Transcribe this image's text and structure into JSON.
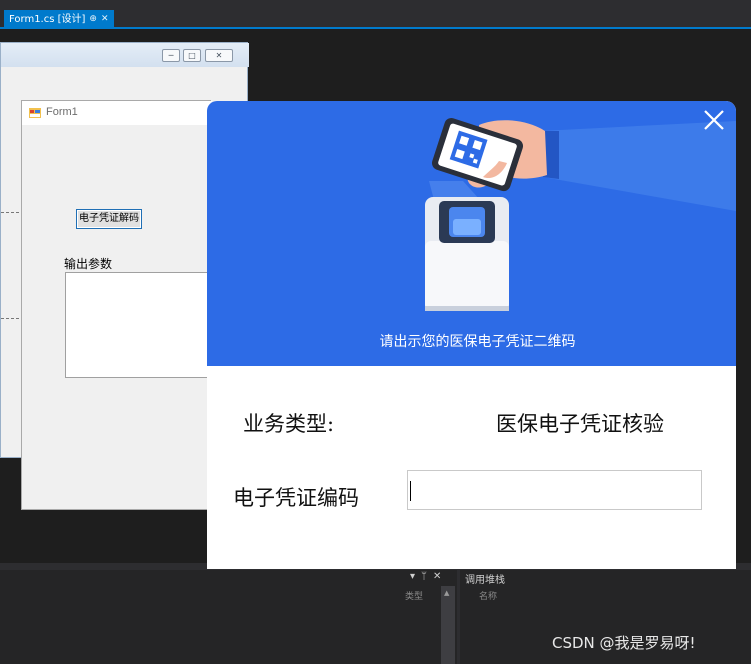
{
  "ide": {
    "doc_tab": {
      "label": "Form1.cs [设计]",
      "pin_glyph": "⊕",
      "close_glyph": "✕"
    },
    "bottom": {
      "left_panel_tools": [
        "▾",
        "ᛘ",
        "✕"
      ],
      "type_column": "类型",
      "call_stack_title": "调用堆栈",
      "name_column": "名称"
    },
    "background_form": {
      "min_glyph": "─",
      "max_glyph": "□",
      "close_glyph": "✕"
    }
  },
  "form1": {
    "title": "Form1",
    "decode_button_label": "电子凭证解码",
    "output_label": "输出参数",
    "output_value": ""
  },
  "dialog": {
    "banner_text": "请出示您的医保电子凭证二维码",
    "business_type_label": "业务类型:",
    "business_type_value": "医保电子凭证核验",
    "code_label": "电子凭证编码",
    "code_value": "",
    "colors": {
      "banner": "#2d6be6",
      "sleeve": "#3d7bea"
    }
  },
  "watermark": "CSDN @我是罗易呀!"
}
